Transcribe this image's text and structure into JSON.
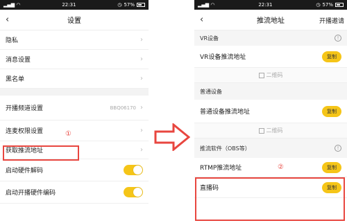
{
  "colors": {
    "accent": "#f5c518",
    "annotation": "#e8463f"
  },
  "left": {
    "status": {
      "time": "22:31",
      "battery": "57%"
    },
    "title": "设置",
    "rows": [
      {
        "label": "隐私"
      },
      {
        "label": "消息设置"
      },
      {
        "label": "黑名单"
      },
      {
        "label": "开播频道设置",
        "value": "BBQ06170"
      },
      {
        "label": "连麦权限设置"
      },
      {
        "label": "获取推流地址"
      },
      {
        "label": "启动硬件解码"
      },
      {
        "label": "启动开播硬件编码"
      }
    ],
    "marker": "①"
  },
  "right": {
    "status": {
      "time": "22:31",
      "battery": "57%"
    },
    "title": "推流地址",
    "action": "开播邀请",
    "sections": [
      {
        "title": "VR设备",
        "row_label": "VR设备推流地址",
        "copy": "复制",
        "qr": "二维码"
      },
      {
        "title": "普通设备",
        "row_label": "普通设备推流地址",
        "copy": "复制",
        "qr": "二维码"
      },
      {
        "title": "推流软件（OBS等）",
        "rows": [
          {
            "label": "RTMP推流地址",
            "copy": "复制"
          },
          {
            "label": "直播码",
            "copy": "复制"
          }
        ]
      }
    ],
    "marker": "②"
  }
}
